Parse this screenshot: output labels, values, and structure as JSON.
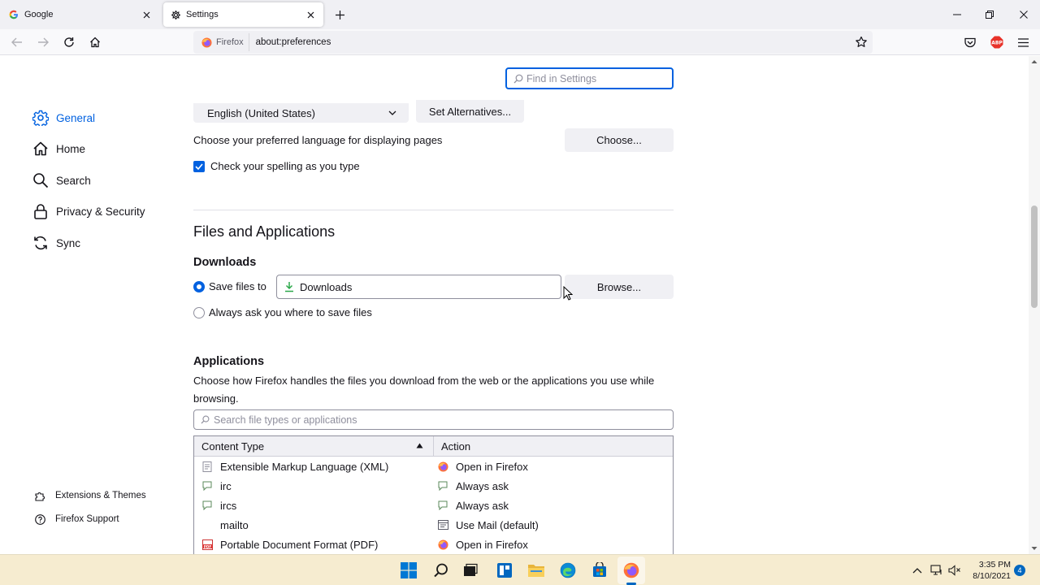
{
  "tabs": [
    {
      "title": "Google",
      "icon": "google-icon"
    },
    {
      "title": "Settings",
      "icon": "gear-icon",
      "active": true
    }
  ],
  "urlbar": {
    "identity": "Firefox",
    "url": "about:preferences"
  },
  "sidebar": {
    "categories": [
      {
        "label": "General",
        "icon": "gear-icon",
        "selected": true
      },
      {
        "label": "Home",
        "icon": "home-icon"
      },
      {
        "label": "Search",
        "icon": "search-icon"
      },
      {
        "label": "Privacy & Security",
        "icon": "lock-icon"
      },
      {
        "label": "Sync",
        "icon": "sync-icon"
      }
    ],
    "footer": [
      {
        "label": "Extensions & Themes",
        "icon": "puzzle-icon"
      },
      {
        "label": "Firefox Support",
        "icon": "help-icon"
      }
    ]
  },
  "search": {
    "placeholder": "Find in Settings"
  },
  "language": {
    "selected": "English (United States)",
    "alternatives_button": "Set Alternatives...",
    "pages_text": "Choose your preferred language for displaying pages",
    "choose_button": "Choose...",
    "spellcheck_label": "Check your spelling as you type",
    "spellcheck_checked": true
  },
  "files_apps": {
    "heading": "Files and Applications",
    "downloads_heading": "Downloads",
    "save_files_label": "Save files to",
    "save_files_selected": true,
    "download_folder": "Downloads",
    "browse_button": "Browse...",
    "always_ask_label": "Always ask you where to save files",
    "applications_heading": "Applications",
    "applications_desc_line1": "Choose how Firefox handles the files you download from the web or the applications you use while",
    "applications_desc_line2": "browsing.",
    "search_placeholder": "Search file types or applications",
    "columns": [
      "Content Type",
      "Action"
    ],
    "rows": [
      {
        "type": "Extensible Markup Language (XML)",
        "type_icon": "xml-file-icon",
        "action": "Open in Firefox",
        "action_icon": "firefox-icon"
      },
      {
        "type": "irc",
        "type_icon": "chat-icon",
        "action": "Always ask",
        "action_icon": "chat-icon"
      },
      {
        "type": "ircs",
        "type_icon": "chat-icon",
        "action": "Always ask",
        "action_icon": "chat-icon"
      },
      {
        "type": "mailto",
        "type_icon": "",
        "action": "Use Mail (default)",
        "action_icon": "mail-app-icon"
      },
      {
        "type": "Portable Document Format (PDF)",
        "type_icon": "pdf-icon",
        "action": "Open in Firefox",
        "action_icon": "firefox-icon"
      }
    ]
  },
  "taskbar": {
    "time": "3:35 PM",
    "date": "8/10/2021",
    "notification_count": "4",
    "apps": [
      "windows-start-icon",
      "search-icon",
      "task-view-icon",
      "widgets-icon",
      "file-explorer-icon",
      "edge-icon",
      "store-icon",
      "firefox-icon"
    ]
  },
  "colors": {
    "accent": "#0061e0",
    "taskbar": "#f6ecd0"
  }
}
